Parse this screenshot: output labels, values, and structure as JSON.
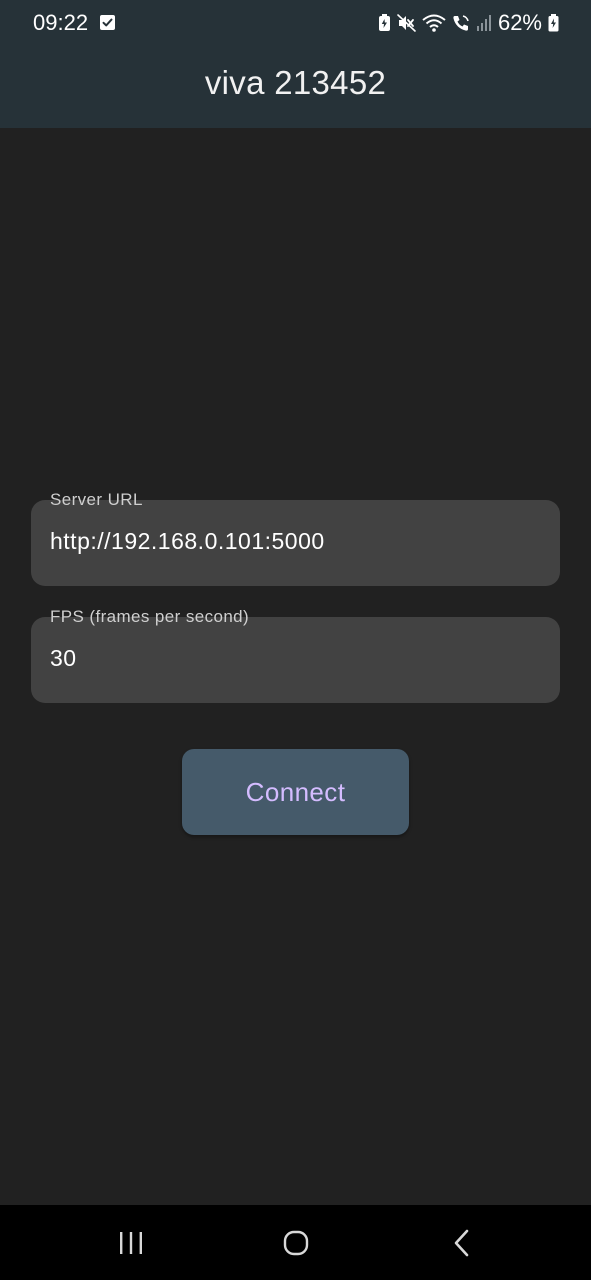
{
  "status_bar": {
    "time": "09:22",
    "battery_percent": "62%",
    "icons": [
      "notification-check-icon",
      "battery-saver-icon",
      "mute-icon",
      "wifi-icon",
      "wifi-calling-icon",
      "signal-icon",
      "battery-charging-icon"
    ]
  },
  "app_bar": {
    "title": "viva 213452",
    "background": "#263238"
  },
  "form": {
    "server_url": {
      "label": "Server URL",
      "value": "http://192.168.0.101:5000"
    },
    "fps": {
      "label": "FPS (frames per second)",
      "value": "30"
    },
    "connect_label": "Connect"
  },
  "nav_bar": {
    "icons": [
      "recent-apps-icon",
      "home-icon",
      "back-icon"
    ]
  },
  "colors": {
    "background": "#212121",
    "field_background": "#424242",
    "button_background": "#455a6a",
    "button_text": "#d4bcff"
  }
}
